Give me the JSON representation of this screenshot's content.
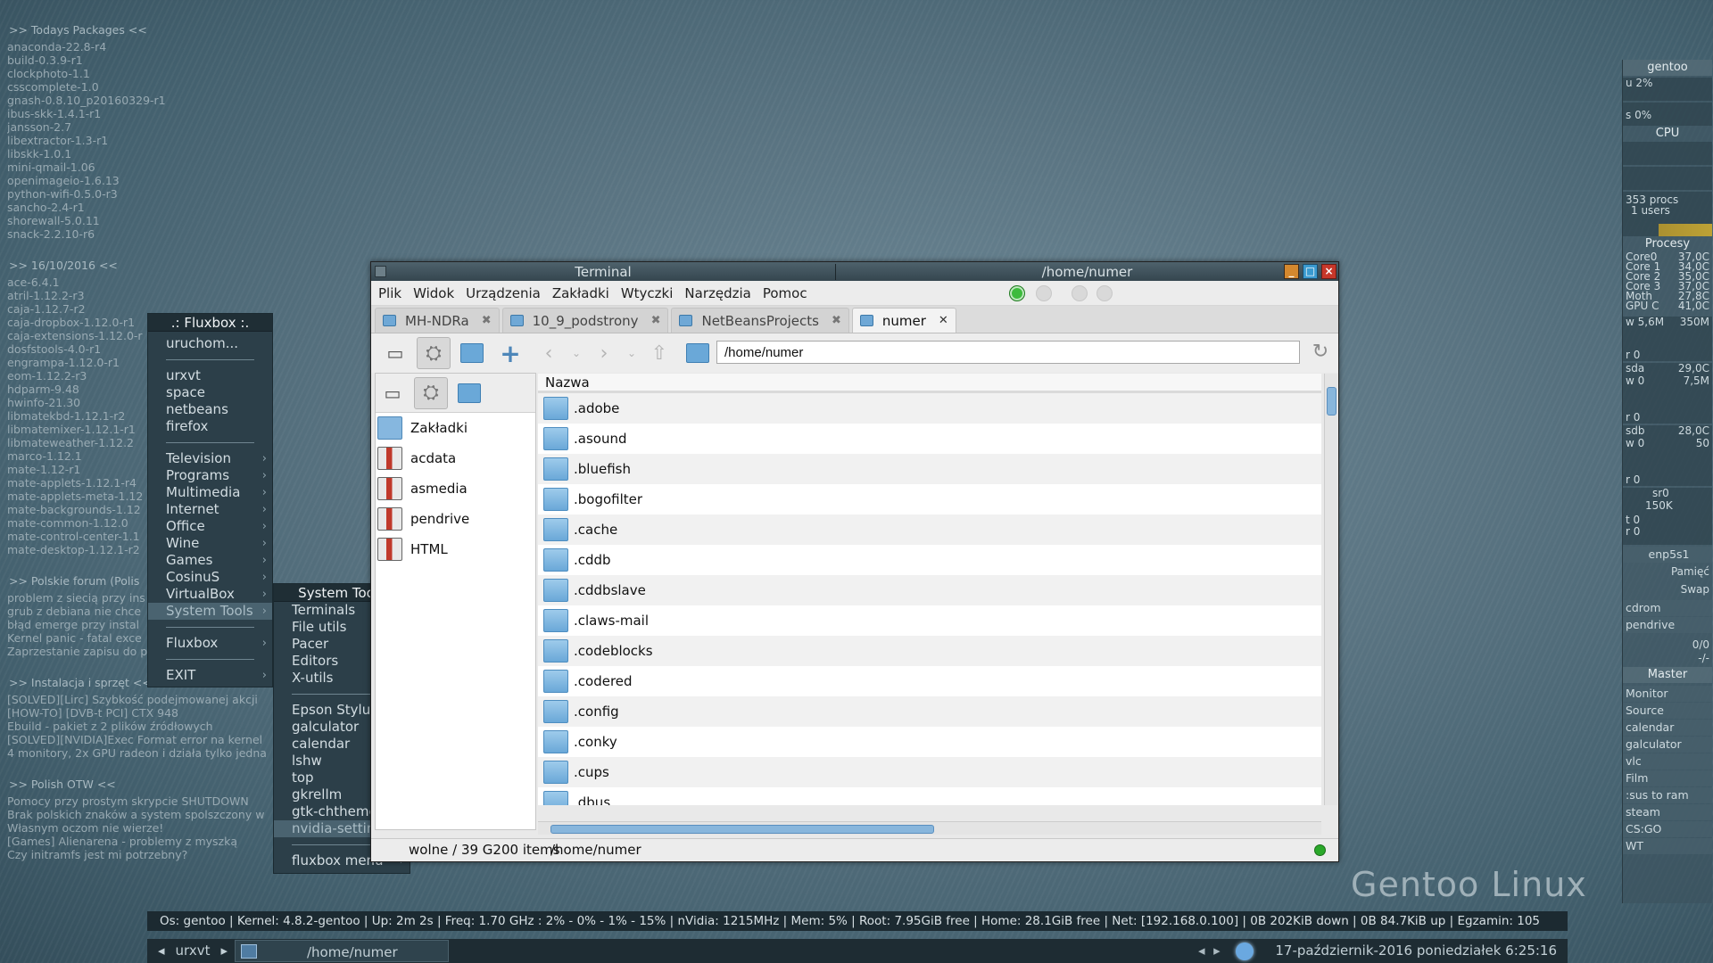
{
  "conky": {
    "sections": [
      {
        "header": ">> Todays Packages <<",
        "lines": [
          "anaconda-22.8-r4",
          "build-0.3.9-r1",
          "clockphoto-1.1",
          "csscomplete-1.0",
          "gnash-0.8.10_p20160329-r1",
          "ibus-skk-1.4.1-r1",
          "jansson-2.7",
          "libextractor-1.3-r1",
          "libskk-1.0.1",
          "mini-qmail-1.06",
          "openimageio-1.6.13",
          "python-wifi-0.5.0-r3",
          "sancho-2.4-r1",
          "shorewall-5.0.11",
          "snack-2.2.10-r6"
        ]
      },
      {
        "header": ">> 16/10/2016 <<",
        "lines": [
          "ace-6.4.1",
          "atril-1.12.2-r3",
          "caja-1.12.7-r2",
          "caja-dropbox-1.12.0-r1",
          "caja-extensions-1.12.0-r",
          "dosfstools-4.0-r1",
          "engrampa-1.12.0-r1",
          "eom-1.12.2-r3",
          "hdparm-9.48",
          "hwinfo-21.30",
          "libmatekbd-1.12.1-r2",
          "libmatemixer-1.12.1-r1",
          "libmateweather-1.12.2",
          "marco-1.12.1",
          "mate-1.12-r1",
          "mate-applets-1.12.1-r4",
          "mate-applets-meta-1.12",
          "mate-backgrounds-1.12",
          "mate-common-1.12.0",
          "mate-control-center-1.1",
          "mate-desktop-1.12.1-r2"
        ]
      },
      {
        "header": ">> Polskie forum (Polis",
        "lines": [
          "problem z siecią przy ins",
          "grub z debiana nie chce",
          "błąd emerge przy instal",
          "Kernel panic - fatal exce",
          "Zaprzestanie zapisu do p"
        ]
      },
      {
        "header": ">> Instalacja i sprzęt <<",
        "lines": [
          "[SOLVED][Lirc] Szybkość podejmowanej akcji",
          "[HOW-TO] [DVB-t PCI] CTX 948",
          "Ebuild - pakiet z 2 plików źródłowych",
          "[SOLVED][NVIDIA]Exec Format error na kernel",
          "4 monitory, 2x GPU radeon i działa tylko jedna"
        ]
      },
      {
        "header": ">> Polish OTW <<",
        "lines": [
          "Pomocy przy prostym skrypcie SHUTDOWN",
          "Brak polskich znaków a system spolszczony w",
          "Własnym oczom nie wierze!",
          "[Games] Alienarena - problemy z myszką",
          "Czy initramfs jest mi potrzebny?"
        ]
      }
    ]
  },
  "fluxbox_menu": {
    "title": ".: Fluxbox :.",
    "items": [
      {
        "label": "uruchom...",
        "type": "item"
      },
      {
        "type": "sep"
      },
      {
        "label": "urxvt",
        "type": "item"
      },
      {
        "label": "space",
        "type": "item"
      },
      {
        "label": "netbeans",
        "type": "item"
      },
      {
        "label": "firefox",
        "type": "item"
      },
      {
        "type": "sep"
      },
      {
        "label": "Television",
        "type": "sub"
      },
      {
        "label": "Programs",
        "type": "sub"
      },
      {
        "label": "Multimedia",
        "type": "sub"
      },
      {
        "label": "Internet",
        "type": "sub"
      },
      {
        "label": "Office",
        "type": "sub"
      },
      {
        "label": "Wine",
        "type": "sub"
      },
      {
        "label": "Games",
        "type": "sub"
      },
      {
        "label": "CosinuS",
        "type": "sub"
      },
      {
        "label": "VirtualBox",
        "type": "sub"
      },
      {
        "label": "System Tools",
        "type": "sub",
        "highlight": true
      },
      {
        "type": "sep"
      },
      {
        "label": "Fluxbox",
        "type": "sub"
      },
      {
        "type": "sep"
      },
      {
        "label": "EXIT",
        "type": "sub"
      }
    ]
  },
  "system_tools_menu": {
    "title": "System Tools",
    "items": [
      {
        "label": "Terminals",
        "type": "sub"
      },
      {
        "label": "File utils",
        "type": "sub"
      },
      {
        "label": "Pacer",
        "type": "sub"
      },
      {
        "label": "Editors",
        "type": "sub"
      },
      {
        "label": "X-utils",
        "type": "sub"
      },
      {
        "type": "sep"
      },
      {
        "label": "Epson Stylus",
        "type": "item"
      },
      {
        "label": "galculator",
        "type": "item"
      },
      {
        "label": "calendar",
        "type": "item"
      },
      {
        "label": "lshw",
        "type": "item"
      },
      {
        "label": "top",
        "type": "item"
      },
      {
        "label": "gkrellm",
        "type": "item"
      },
      {
        "label": "gtk-chtheme",
        "type": "item"
      },
      {
        "label": "nvidia-settings",
        "type": "item",
        "highlight": true
      },
      {
        "type": "sep"
      },
      {
        "label": "fluxbox menu",
        "type": "sub"
      }
    ]
  },
  "window": {
    "title_left": "Terminal",
    "title_right": "/home/numer",
    "buttons": {
      "minimize": "_",
      "maximize": "□",
      "close": "×"
    },
    "menu": [
      "Plik",
      "Widok",
      "Urządzenia",
      "Zakładki",
      "Wtyczki",
      "Narzędzia",
      "Pomoc"
    ],
    "tabs": [
      {
        "label": "MH-NDRa",
        "active": false
      },
      {
        "label": "10_9_podstrony",
        "active": false
      },
      {
        "label": "NetBeansProjects",
        "active": false
      },
      {
        "label": "numer",
        "active": true
      }
    ],
    "location": "/home/numer",
    "sidebar": [
      {
        "label": "Zakładki",
        "icon": "folder-icon"
      },
      {
        "label": "acdata",
        "icon": "bookmark-icon"
      },
      {
        "label": "asmedia",
        "icon": "bookmark-icon"
      },
      {
        "label": "pendrive",
        "icon": "bookmark-icon"
      },
      {
        "label": "HTML",
        "icon": "bookmark-icon"
      }
    ],
    "column_header": "Nazwa",
    "files": [
      ".adobe",
      ".asound",
      ".bluefish",
      ".bogofilter",
      ".cache",
      ".cddb",
      ".cddbslave",
      ".claws-mail",
      ".codeblocks",
      ".codered",
      ".config",
      ".conky",
      ".cups",
      ".dbus"
    ],
    "status_free": "wolne / 39 G200 items",
    "status_path": "/home/numer",
    "status_led_color": "#2aa82a"
  },
  "gkrellm": {
    "host": "gentoo",
    "cpu_u": "u 2%",
    "cpu_s": "s 0%",
    "cpu_label": "CPU",
    "procs": "353 procs",
    "users": "1 users",
    "procs_label": "Procesy",
    "temps": [
      {
        "name": "Core0",
        "val": "37,0C"
      },
      {
        "name": "Core 1",
        "val": "34,0C"
      },
      {
        "name": "Core 2",
        "val": "35,0C"
      },
      {
        "name": "Core 3",
        "val": "37,0C"
      },
      {
        "name": "Moth",
        "val": "27,8C"
      },
      {
        "name": "GPU C",
        "val": "41,0C"
      }
    ],
    "disk_w": "w 5,6M",
    "disk_w_val": "350M",
    "disk_r": "r 0",
    "sda_label": "sda",
    "sda_temp": "29,0C",
    "sda_w": "w 0",
    "sda_w_val": "7,5M",
    "sda_r": "r 0",
    "sdb_label": "sdb",
    "sdb_temp": "28,0C",
    "sdb_w": "w 0",
    "sdb_w_val": "50",
    "sdb_r": "r 0",
    "sr0_label": "sr0",
    "sr0_val": "150K",
    "sr0_t": "t 0",
    "sr0_r": "r 0",
    "net_label": "enp5s1",
    "mem_label": "Pamięć",
    "swap_label": "Swap",
    "cdrom_label": "cdrom",
    "pendrive_label": "pendrive",
    "mail_val": "0/0",
    "mail_dash": "-/-",
    "master_label": "Master",
    "launchers": [
      "Monitor",
      "Source",
      "calendar",
      "galculator",
      "vlc",
      "Film",
      ":sus to ram",
      "steam",
      "CS:GO",
      "WT"
    ]
  },
  "wallpaper_text": "Gentoo Linux",
  "sysbar": "Os: gentoo | Kernel: 4.8.2-gentoo | Up: 2m 2s | Freq: 1.70 GHz : 2% - 0% - 1% - 15%  | nVidia: 1215MHz | Mem: 5% | Root: 7.95GiB free | Home: 28.1GiB free | Net: [192.168.0.100] |   0B    202KiB  down |    0B   84.7KiB   up |  Egzamin: 105",
  "taskbar": {
    "workspace": "urxvt",
    "task_title": "/home/numer",
    "clock": "17-październik-2016 poniedziałek   6:25:16"
  }
}
